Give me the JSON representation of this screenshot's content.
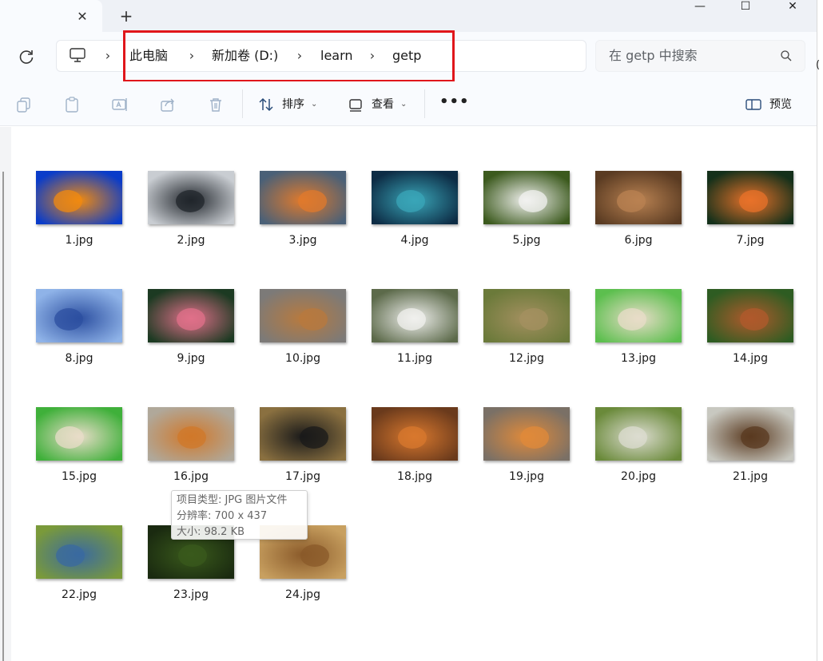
{
  "tabs": {
    "close_icon": "close-icon",
    "new_tab_icon": "plus-icon"
  },
  "window": {
    "minimize": "—",
    "maximize": "☐",
    "close": "✕"
  },
  "address_bar": {
    "breadcrumbs": [
      "此电脑",
      "新加卷 (D:)",
      "learn",
      "getp"
    ],
    "highlight_color": "#e0161b"
  },
  "search": {
    "placeholder": "在 getp 中搜索"
  },
  "toolbar": {
    "sort_label": "排序",
    "view_label": "查看",
    "preview_label": "预览",
    "more_label": "•••"
  },
  "files": [
    {
      "name": "1.jpg",
      "colors": [
        "#0a3cc9",
        "#f08a10"
      ]
    },
    {
      "name": "2.jpg",
      "colors": [
        "#c9cdd2",
        "#20252b"
      ]
    },
    {
      "name": "3.jpg",
      "colors": [
        "#4a6077",
        "#e07a2c"
      ]
    },
    {
      "name": "4.jpg",
      "colors": [
        "#0d2c45",
        "#3aa6b8"
      ]
    },
    {
      "name": "5.jpg",
      "colors": [
        "#3c5a1e",
        "#f2f2f0"
      ]
    },
    {
      "name": "6.jpg",
      "colors": [
        "#5a3b22",
        "#b98252"
      ]
    },
    {
      "name": "7.jpg",
      "colors": [
        "#14301a",
        "#e8722a"
      ]
    },
    {
      "name": "8.jpg",
      "colors": [
        "#8fb3e8",
        "#2c4fa0"
      ]
    },
    {
      "name": "9.jpg",
      "colors": [
        "#1c3a22",
        "#e0708a"
      ]
    },
    {
      "name": "10.jpg",
      "colors": [
        "#7c7a78",
        "#b87a3e"
      ]
    },
    {
      "name": "11.jpg",
      "colors": [
        "#5c6a4a",
        "#f0f0ee"
      ]
    },
    {
      "name": "12.jpg",
      "colors": [
        "#6b7a3a",
        "#a49060"
      ]
    },
    {
      "name": "13.jpg",
      "colors": [
        "#5cbf4e",
        "#e8dcc8"
      ]
    },
    {
      "name": "14.jpg",
      "colors": [
        "#2e5c22",
        "#b05a2c"
      ]
    },
    {
      "name": "15.jpg",
      "colors": [
        "#3fb03a",
        "#e8dcc8"
      ]
    },
    {
      "name": "16.jpg",
      "colors": [
        "#b0a89a",
        "#d0782a"
      ]
    },
    {
      "name": "17.jpg",
      "colors": [
        "#8a7040",
        "#1a1a1a"
      ]
    },
    {
      "name": "18.jpg",
      "colors": [
        "#6a3a1c",
        "#d8782e"
      ]
    },
    {
      "name": "19.jpg",
      "colors": [
        "#7a7066",
        "#e08a3a"
      ]
    },
    {
      "name": "20.jpg",
      "colors": [
        "#6a8a3a",
        "#dcdcd0"
      ]
    },
    {
      "name": "21.jpg",
      "colors": [
        "#c8c8c0",
        "#5a3a20"
      ]
    },
    {
      "name": "22.jpg",
      "colors": [
        "#7a9a3a",
        "#3a6aa0"
      ]
    },
    {
      "name": "23.jpg",
      "colors": [
        "#1a2a10",
        "#3a5a1c"
      ]
    },
    {
      "name": "24.jpg",
      "colors": [
        "#c8a060",
        "#8a5a2a"
      ]
    }
  ],
  "tooltip": {
    "type_line": "项目类型: JPG 图片文件",
    "resolution_line": "分辨率: 700 x 437",
    "size_line": "大小: 98.2 KB"
  }
}
